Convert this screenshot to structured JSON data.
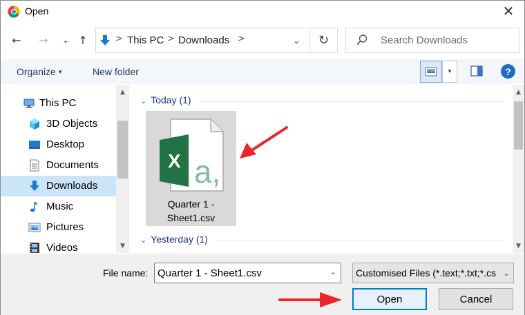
{
  "window": {
    "title": "Open",
    "close_glyph": "✕",
    "app_icon": "chrome-icon"
  },
  "address_bar": {
    "back_glyph": "←",
    "forward_glyph": "→",
    "recent_glyph": "⌄",
    "up_glyph": "↑",
    "crumbs": [
      "This PC",
      "Downloads"
    ],
    "crumb_separator": ">",
    "dropdown_glyph": "⌄",
    "refresh_glyph": "↻"
  },
  "search": {
    "placeholder": "Search Downloads"
  },
  "toolbar": {
    "organize_label": "Organize",
    "organize_caret": "▾",
    "new_folder_label": "New folder",
    "view_dropdown_glyph": "▾",
    "help_glyph": "?"
  },
  "nav_pane": {
    "items": [
      {
        "label": "This PC",
        "icon": "this-pc-icon"
      },
      {
        "label": "3D Objects",
        "icon": "3d-objects-icon"
      },
      {
        "label": "Desktop",
        "icon": "desktop-icon"
      },
      {
        "label": "Documents",
        "icon": "documents-icon"
      },
      {
        "label": "Downloads",
        "icon": "downloads-icon",
        "selected": true
      },
      {
        "label": "Music",
        "icon": "music-icon"
      },
      {
        "label": "Pictures",
        "icon": "pictures-icon"
      },
      {
        "label": "Videos",
        "icon": "videos-icon"
      }
    ],
    "scroll_up": "▲",
    "scroll_down": "▼"
  },
  "file_pane": {
    "groups": [
      {
        "header": "Today (1)",
        "chevron": "⌄"
      },
      {
        "header": "Yesterday (1)",
        "chevron": "⌄"
      }
    ],
    "files": [
      {
        "name_line1": "Quarter 1 -",
        "name_line2": "Sheet1.csv",
        "icon": "excel-csv-file-icon",
        "selected": true
      }
    ]
  },
  "bottom": {
    "file_name_label": "File name:",
    "file_name_value": "Quarter 1 - Sheet1.csv",
    "file_type_value": "Customised Files (*.text;*.txt;*.cs",
    "dropdown_glyph": "⌄",
    "open_label": "Open",
    "cancel_label": "Cancel"
  },
  "colors": {
    "selection": "#cce4f7",
    "tile_selection": "#d9d9d9",
    "accent": "#0078d7",
    "excel_green": "#217346",
    "annotation_red": "#e8262b"
  }
}
